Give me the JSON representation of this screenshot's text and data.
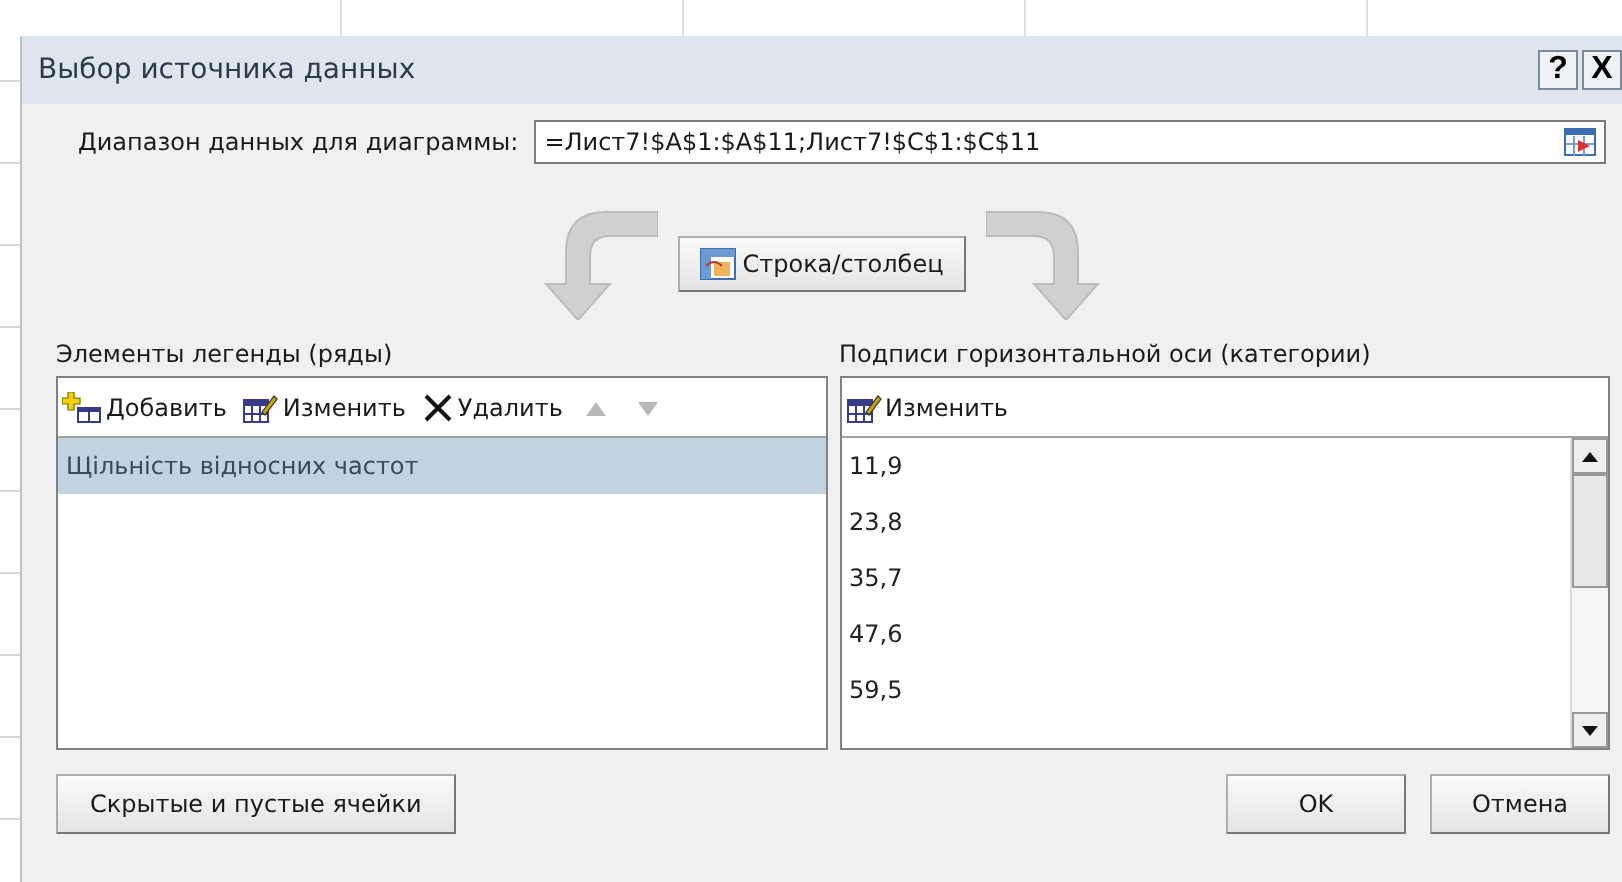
{
  "window": {
    "title": "Выбор источника данных",
    "help_button": "?",
    "close_button": "X"
  },
  "range": {
    "label": "Диапазон данных для диаграммы:",
    "value": "=Лист7!$A$1:$A$11;Лист7!$C$1:$C$11"
  },
  "switch_button": "Строка/столбец",
  "legend": {
    "label": "Элементы легенды (ряды)",
    "add": "Добавить",
    "edit": "Изменить",
    "remove": "Удалить",
    "move_up_disabled": true,
    "move_down_disabled": true,
    "items": [
      {
        "label": "Щільність відносних частот",
        "selected": true
      }
    ]
  },
  "axis": {
    "label": "Подписи горизонтальной оси (категории)",
    "edit": "Изменить",
    "items": [
      {
        "label": "11,9",
        "selected": false
      },
      {
        "label": "23,8",
        "selected": false
      },
      {
        "label": "35,7",
        "selected": false
      },
      {
        "label": "47,6",
        "selected": false
      },
      {
        "label": "59,5",
        "selected": false
      }
    ]
  },
  "buttons": {
    "hidden_cells": "Скрытые и пустые ячейки",
    "ok": "OK",
    "cancel": "Отмена"
  }
}
